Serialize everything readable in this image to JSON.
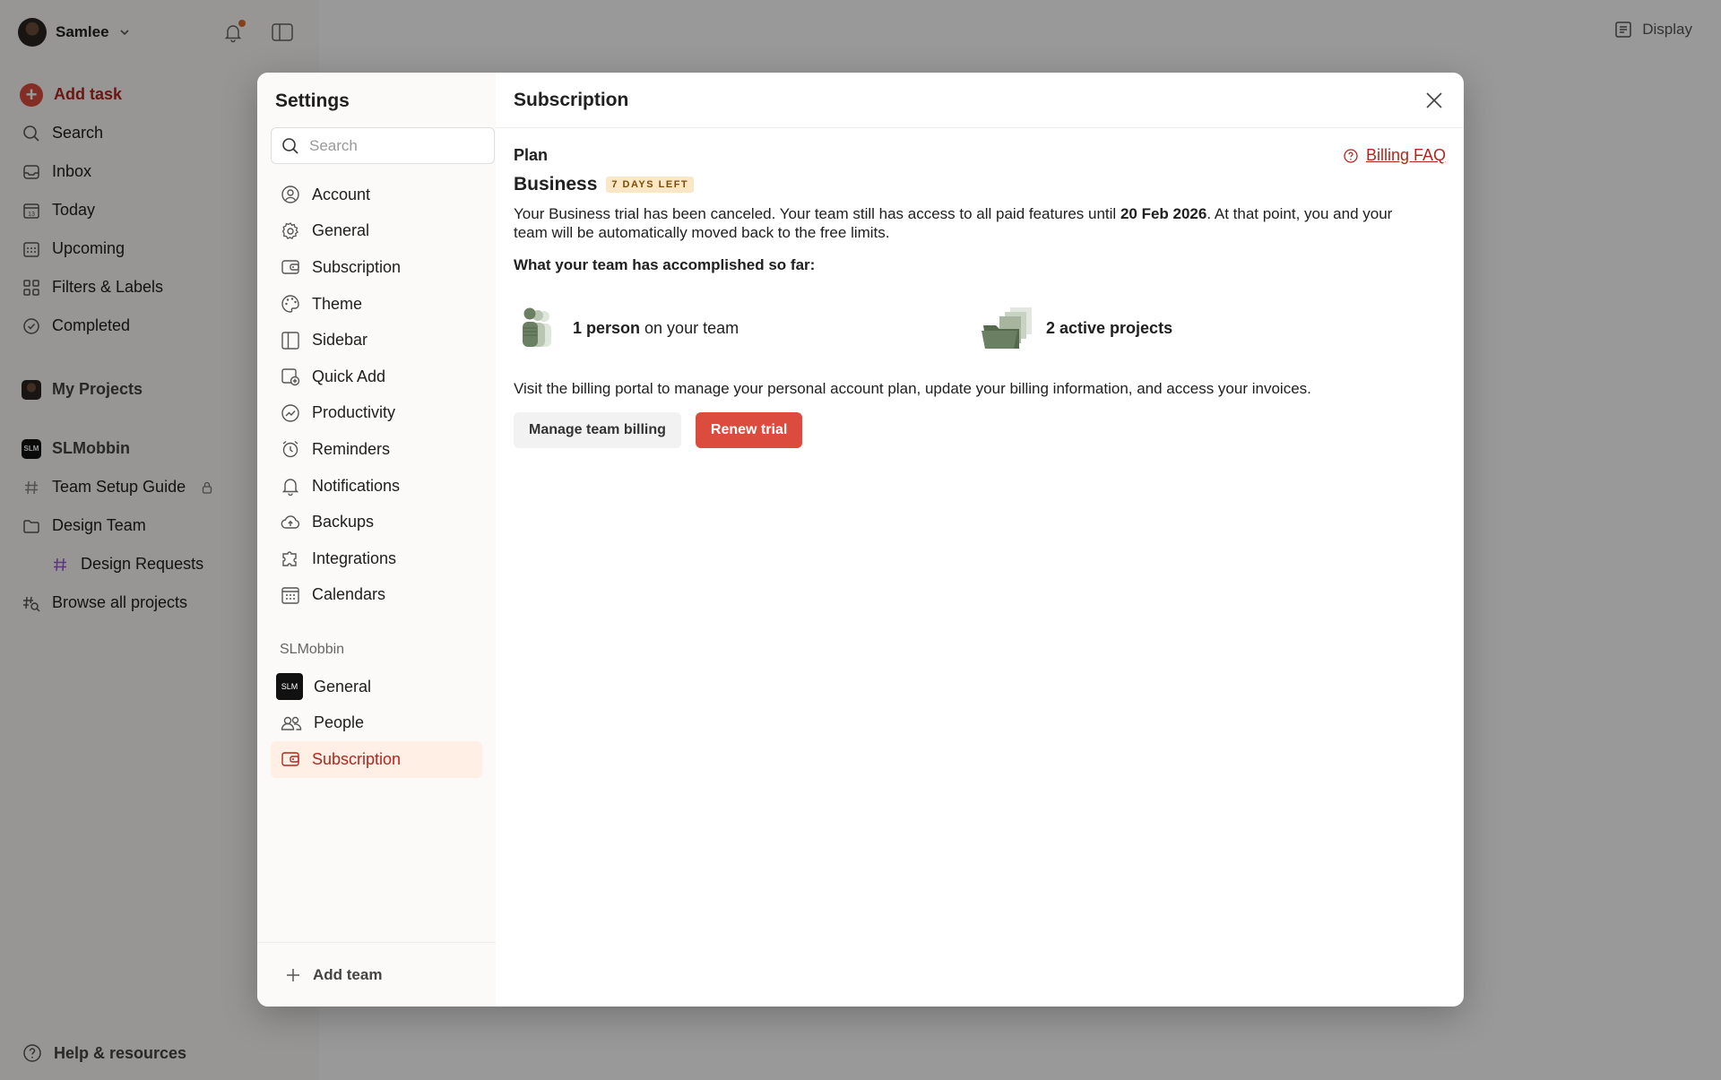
{
  "sidebar": {
    "user_name": "Samlee",
    "add_task": "Add task",
    "nav": [
      "Search",
      "Inbox",
      "Today",
      "Upcoming",
      "Filters & Labels",
      "Completed"
    ],
    "my_projects": "My Projects",
    "team": "SLMobbin",
    "team_logo": "SLM",
    "projects": {
      "team_setup": "Team Setup Guide",
      "design_team": "Design Team",
      "design_requests": "Design Requests",
      "browse": "Browse all projects"
    },
    "help": "Help & resources"
  },
  "topbar": {
    "display": "Display"
  },
  "settings": {
    "title": "Settings",
    "search_placeholder": "Search",
    "items": [
      "Account",
      "General",
      "Subscription",
      "Theme",
      "Sidebar",
      "Quick Add",
      "Productivity",
      "Reminders",
      "Notifications",
      "Backups",
      "Integrations",
      "Calendars"
    ],
    "team_group": "SLMobbin",
    "team_logo": "SLM",
    "team_items": [
      "General",
      "People",
      "Subscription"
    ],
    "add_team": "Add team"
  },
  "subscription": {
    "title": "Subscription",
    "plan_label": "Plan",
    "billing_faq": "Billing FAQ",
    "plan_name": "Business",
    "badge": "7 DAYS LEFT",
    "desc_before": "Your Business trial has been canceled. Your team still has access to all paid features until ",
    "desc_date": "20 Feb 2026",
    "desc_after": ". At that point, you and your team will be automatically moved back to the free limits.",
    "accomplished": "What your team has accomplished so far:",
    "stat_people_bold": "1 person",
    "stat_people_rest": " on your team",
    "stat_projects": "2 active projects",
    "portal_text": "Visit the billing portal to manage your personal account plan, update your billing information, and access your invoices.",
    "manage_billing": "Manage team billing",
    "renew_trial": "Renew trial"
  },
  "colors": {
    "accent": "#dc4c3e",
    "accent_text": "#b3261e",
    "active_bg": "#ffefe5",
    "badge_bg": "#fbe7c6",
    "illustration": "#6b7f62"
  }
}
